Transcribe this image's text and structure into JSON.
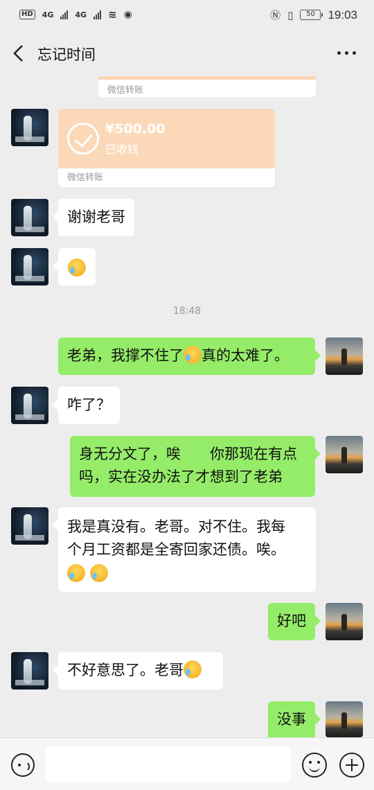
{
  "status_bar": {
    "left_labels": [
      "HD",
      "4G",
      "4G"
    ],
    "battery": "50",
    "time": "19:03"
  },
  "header": {
    "title": "忘记时间"
  },
  "transfer_prev": {
    "label": "微信转账"
  },
  "transfer": {
    "amount": "¥500.00",
    "state": "已收钱",
    "label": "微信转账"
  },
  "messages": [
    {
      "side": "in",
      "text": "谢谢老哥"
    },
    {
      "side": "in",
      "text": "",
      "emoji": 1
    },
    {
      "side": "out",
      "text_before": "老弟，我撑不住了",
      "text_after": "真的太难了。"
    },
    {
      "side": "in",
      "text": "咋了？"
    },
    {
      "side": "out",
      "line1": "身无分文了，唉　　你那现在有点",
      "line2": "吗，实在没办法了才想到了老弟"
    },
    {
      "side": "in",
      "line1": "我是真没有。老哥。对不住。我每",
      "line2": "个月工资都是全寄回家还债。唉。"
    },
    {
      "side": "out",
      "text": "好吧"
    },
    {
      "side": "in",
      "text": "不好意思了。老哥"
    },
    {
      "side": "out",
      "text": "没事"
    }
  ],
  "timestamp": "18:48"
}
